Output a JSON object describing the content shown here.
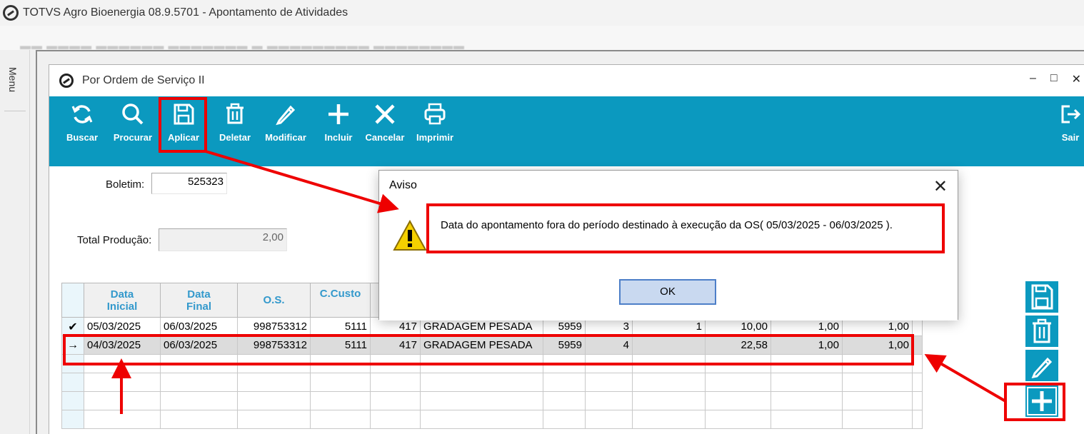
{
  "app": {
    "title": "TOTVS Agro Bioenergia 08.9.5701 - Apontamento de Atividades",
    "menu_label": "Menu"
  },
  "window": {
    "title": "Por Ordem de Serviço II",
    "controls": [
      "–",
      "□",
      "✕"
    ]
  },
  "toolbar": {
    "buttons": [
      {
        "label": "Buscar",
        "icon": "refresh-icon"
      },
      {
        "label": "Procurar",
        "icon": "search-icon"
      },
      {
        "label": "Aplicar",
        "icon": "save-icon"
      },
      {
        "label": "Deletar",
        "icon": "trash-icon"
      },
      {
        "label": "Modificar",
        "icon": "pencil-icon"
      },
      {
        "label": "Incluir",
        "icon": "plus-icon"
      },
      {
        "label": "Cancelar",
        "icon": "x-icon"
      },
      {
        "label": "Imprimir",
        "icon": "printer-icon"
      },
      {
        "label": "Sair",
        "icon": "exit-icon"
      }
    ],
    "color": "#0b99bf"
  },
  "form": {
    "boletim_label": "Boletim:",
    "boletim_value": "525323",
    "total_label": "Total Produção:",
    "total_value": "2,00"
  },
  "grid": {
    "headers": [
      "Data\nInicial",
      "Data\nFinal",
      "O.S.",
      "C.Custo"
    ],
    "rows": [
      {
        "indicator": "✔",
        "cells": [
          "05/03/2025",
          "06/03/2025",
          "998753312",
          "5111",
          "417",
          "GRADAGEM PESADA",
          "5959",
          "3",
          "1",
          "10,00",
          "1,00",
          "1,00"
        ]
      },
      {
        "indicator": "→",
        "cells": [
          "04/03/2025",
          "06/03/2025",
          "998753312",
          "5111",
          "417",
          "GRADAGEM PESADA",
          "5959",
          "4",
          "",
          "22,58",
          "1,00",
          "1,00"
        ]
      }
    ]
  },
  "dialog": {
    "title": "Aviso",
    "message": "Data do apontamento fora do período destinado à execução da OS( 05/03/2025 - 06/03/2025 ).",
    "ok_label": "OK",
    "icon": "warning-icon"
  },
  "side_buttons": [
    "save-icon",
    "trash-icon",
    "pencil-icon",
    "plus-icon"
  ],
  "annotation_color": "#ee0000"
}
